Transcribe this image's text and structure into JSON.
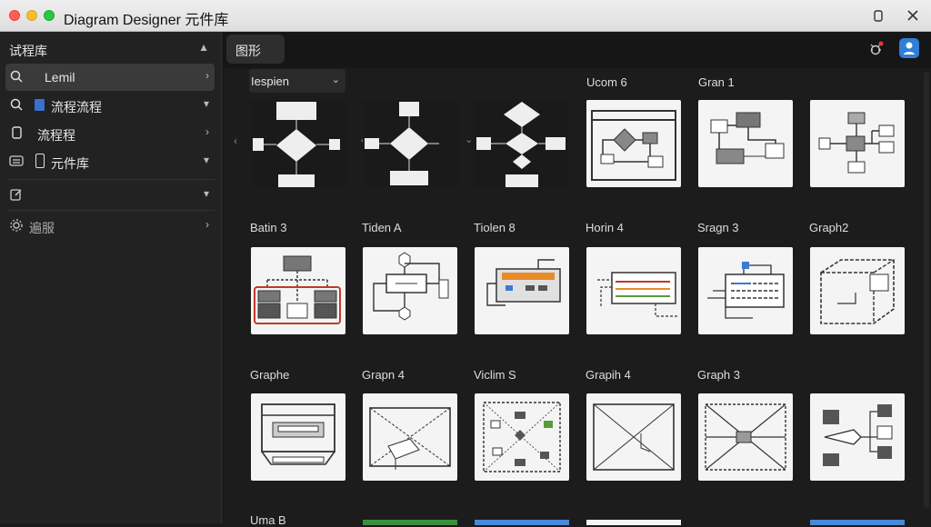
{
  "window": {
    "title": "Diagram Designer 元件库"
  },
  "sidebar": {
    "header": "试程库",
    "items": [
      {
        "label": "Lemil",
        "icon": "search-icon"
      },
      {
        "label": "流程流程",
        "icon": "search-icon"
      },
      {
        "label": "流程程",
        "icon": "document-icon"
      },
      {
        "label": "元件库",
        "icon": "phone-icon"
      },
      {
        "label": "",
        "icon": "edit-icon"
      },
      {
        "label": "遍服",
        "icon": "gear-icon"
      }
    ]
  },
  "main": {
    "tab_label": "图形",
    "filter": {
      "value": "Iespien"
    },
    "cards": [
      {
        "title": ""
      },
      {
        "title": ""
      },
      {
        "title": ""
      },
      {
        "title": "Ucom 6"
      },
      {
        "title": "Gran 1"
      },
      {
        "title": ""
      },
      {
        "title": "Batin 3"
      },
      {
        "title": "Tiden A"
      },
      {
        "title": "Tiolen 8"
      },
      {
        "title": "Horin 4"
      },
      {
        "title": "Sragn 3"
      },
      {
        "title": "Graph2"
      },
      {
        "title": "Graphe"
      },
      {
        "title": "Grapn 4"
      },
      {
        "title": "Viclim S"
      },
      {
        "title": "Grapih 4"
      },
      {
        "title": "Graph 3"
      },
      {
        "title": ""
      },
      {
        "title": "Uma B"
      }
    ]
  },
  "colors": {
    "accent": "#2f7ed8",
    "red_dot": "#e03a3a"
  }
}
